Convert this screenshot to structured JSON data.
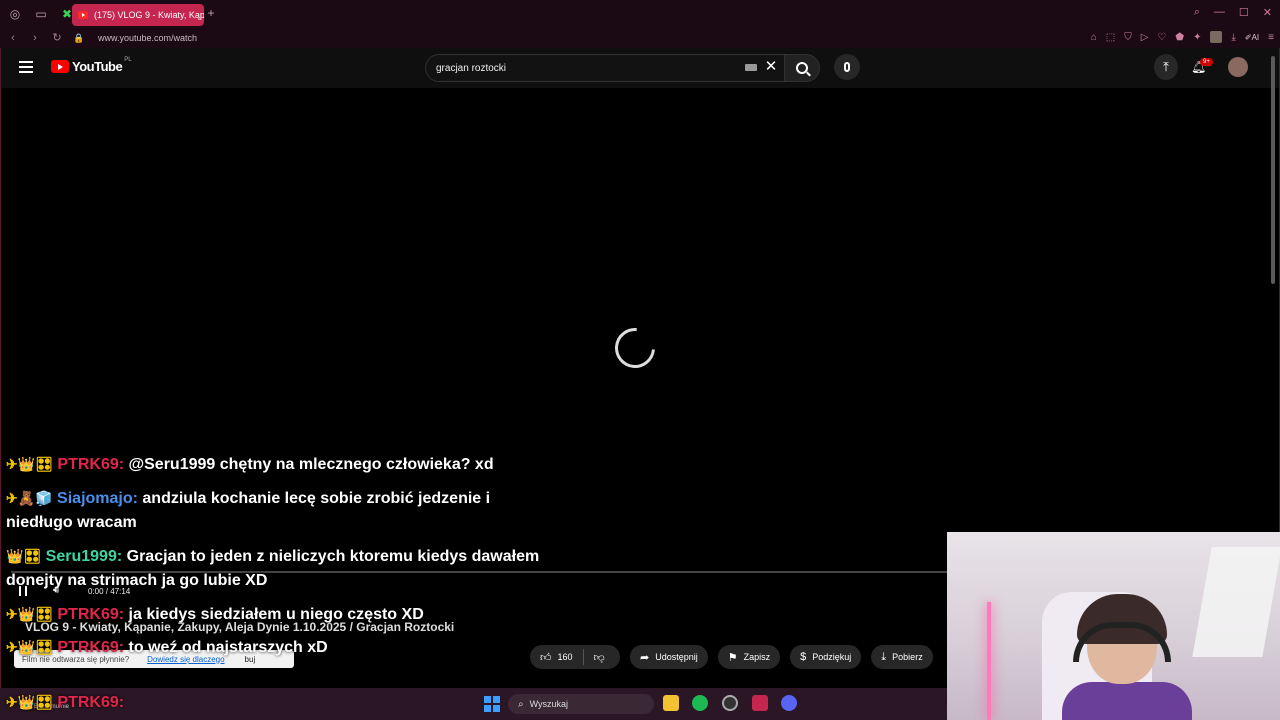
{
  "browser": {
    "tab_title": "(175) VLOG 9 - Kwiaty, Kąp",
    "url": "www.youtube.com/watch"
  },
  "youtube": {
    "logo_text": "YouTube",
    "region": "PL",
    "search_value": "gracjan roztocki",
    "notification_badge": "9+"
  },
  "player": {
    "time": "0:00 / 47:14",
    "title": "VLOG 9 - Kwiaty, Kąpanie, Zakupy, Aleja Dynie 1.10.2025 / Gracjan Roztocki",
    "notice_text": "Film nie odtwarza się płynnie?",
    "notice_link": "Dowiedz się dlaczego",
    "notice_close": "buj"
  },
  "actions": {
    "likes": "160",
    "share": "Udostępnij",
    "save": "Zapisz",
    "thanks": "Podziękuj",
    "download": "Pobierz"
  },
  "chat": [
    {
      "badges": "✈👑🎛",
      "user": "PTRK69:",
      "user_color": "#e0264a",
      "text": "@Seru1999 chętny na mlecznego człowieka? xd"
    },
    {
      "badges": "✈🧸🧊",
      "user": "Siajomajo:",
      "user_color": "#4a8fe8",
      "text": "andziula kochanie lecę sobie zrobić jedzenie i niedługo wracam"
    },
    {
      "badges": "👑🎛",
      "user": "Seru1999:",
      "user_color": "#3fd3a0",
      "text": "Gracjan to jeden z nieliczych ktoremu kiedys dawałem donejty na strimach ja go lubie XD"
    },
    {
      "badges": "✈👑🎛",
      "user": "PTRK69:",
      "user_color": "#e0264a",
      "text": "ja kiedys siedziałem u niego często XD"
    },
    {
      "badges": "✈👑🎛",
      "user": "PTRK69:",
      "user_color": "#e0264a",
      "text": "to weź od najstarszych xD"
    },
    {
      "badges": "✈👑🎛",
      "user": "PTRK69:",
      "user_color": "#e0264a",
      "text": ""
    }
  ],
  "taskbar": {
    "search_placeholder": "Wyszukaj",
    "left_label": "Bezchmurnie"
  }
}
